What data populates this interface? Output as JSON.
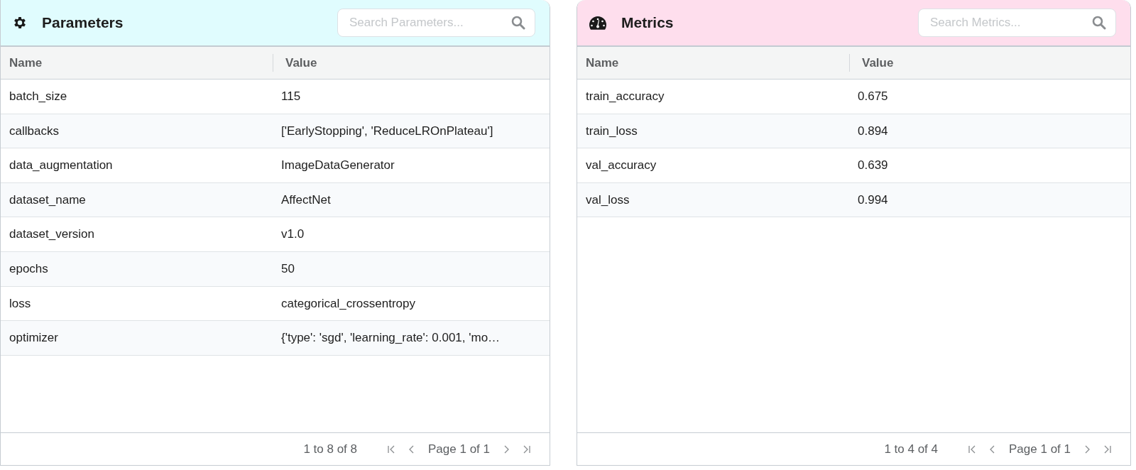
{
  "panels": [
    {
      "kind": "parameters",
      "title": "Parameters",
      "search": {
        "placeholder": "Search Parameters..."
      },
      "columns": [
        "Name",
        "Value"
      ],
      "rows": [
        [
          "batch_size",
          "115"
        ],
        [
          "callbacks",
          "['EarlyStopping', 'ReduceLROnPlateau']"
        ],
        [
          "data_augmentation",
          "ImageDataGenerator"
        ],
        [
          "dataset_name",
          "AffectNet"
        ],
        [
          "dataset_version",
          "v1.0"
        ],
        [
          "epochs",
          "50"
        ],
        [
          "loss",
          "categorical_crossentropy"
        ],
        [
          "optimizer",
          "{'type': 'sgd', 'learning_rate': 0.001, 'mo…"
        ]
      ],
      "footer": {
        "summary": "1 to 8 of 8",
        "page": "Page 1 of 1"
      }
    },
    {
      "kind": "metrics",
      "title": "Metrics",
      "search": {
        "placeholder": "Search Metrics..."
      },
      "columns": [
        "Name",
        "Value"
      ],
      "rows": [
        [
          "train_accuracy",
          "0.675"
        ],
        [
          "train_loss",
          "0.894"
        ],
        [
          "val_accuracy",
          "0.639"
        ],
        [
          "val_loss",
          "0.994"
        ]
      ],
      "footer": {
        "summary": "1 to 4 of 4",
        "page": "Page 1 of 1"
      }
    }
  ]
}
